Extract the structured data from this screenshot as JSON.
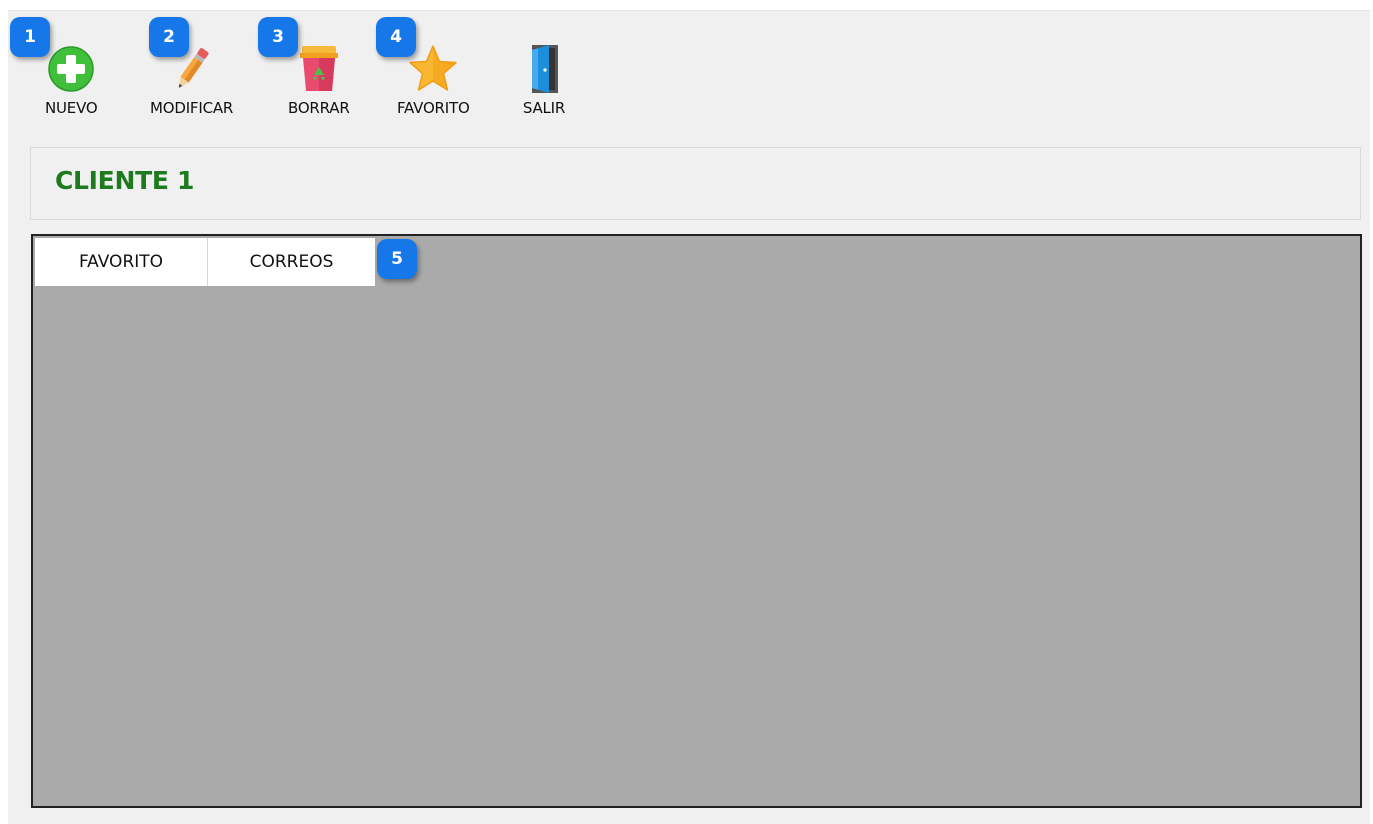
{
  "toolbar": {
    "nuevo": {
      "label": "NUEVO",
      "icon": "plus-circle-icon",
      "badge": "1"
    },
    "modificar": {
      "label": "MODIFICAR",
      "icon": "pencil-icon",
      "badge": "2"
    },
    "borrar": {
      "label": "BORRAR",
      "icon": "recycle-bin-icon",
      "badge": "3"
    },
    "favorito": {
      "label": "FAVORITO",
      "icon": "star-icon",
      "badge": "4"
    },
    "salir": {
      "label": "SALIR",
      "icon": "door-exit-icon"
    }
  },
  "header": {
    "title": "CLIENTE 1",
    "title_color": "#1e7a1e"
  },
  "tabs": {
    "items": [
      {
        "label": "FAVORITO"
      },
      {
        "label": "CORREOS"
      }
    ],
    "badge": "5"
  },
  "colors": {
    "badge": "#1577e8",
    "content_background": "#aaaaaa",
    "window_background": "#f0f0f0"
  }
}
